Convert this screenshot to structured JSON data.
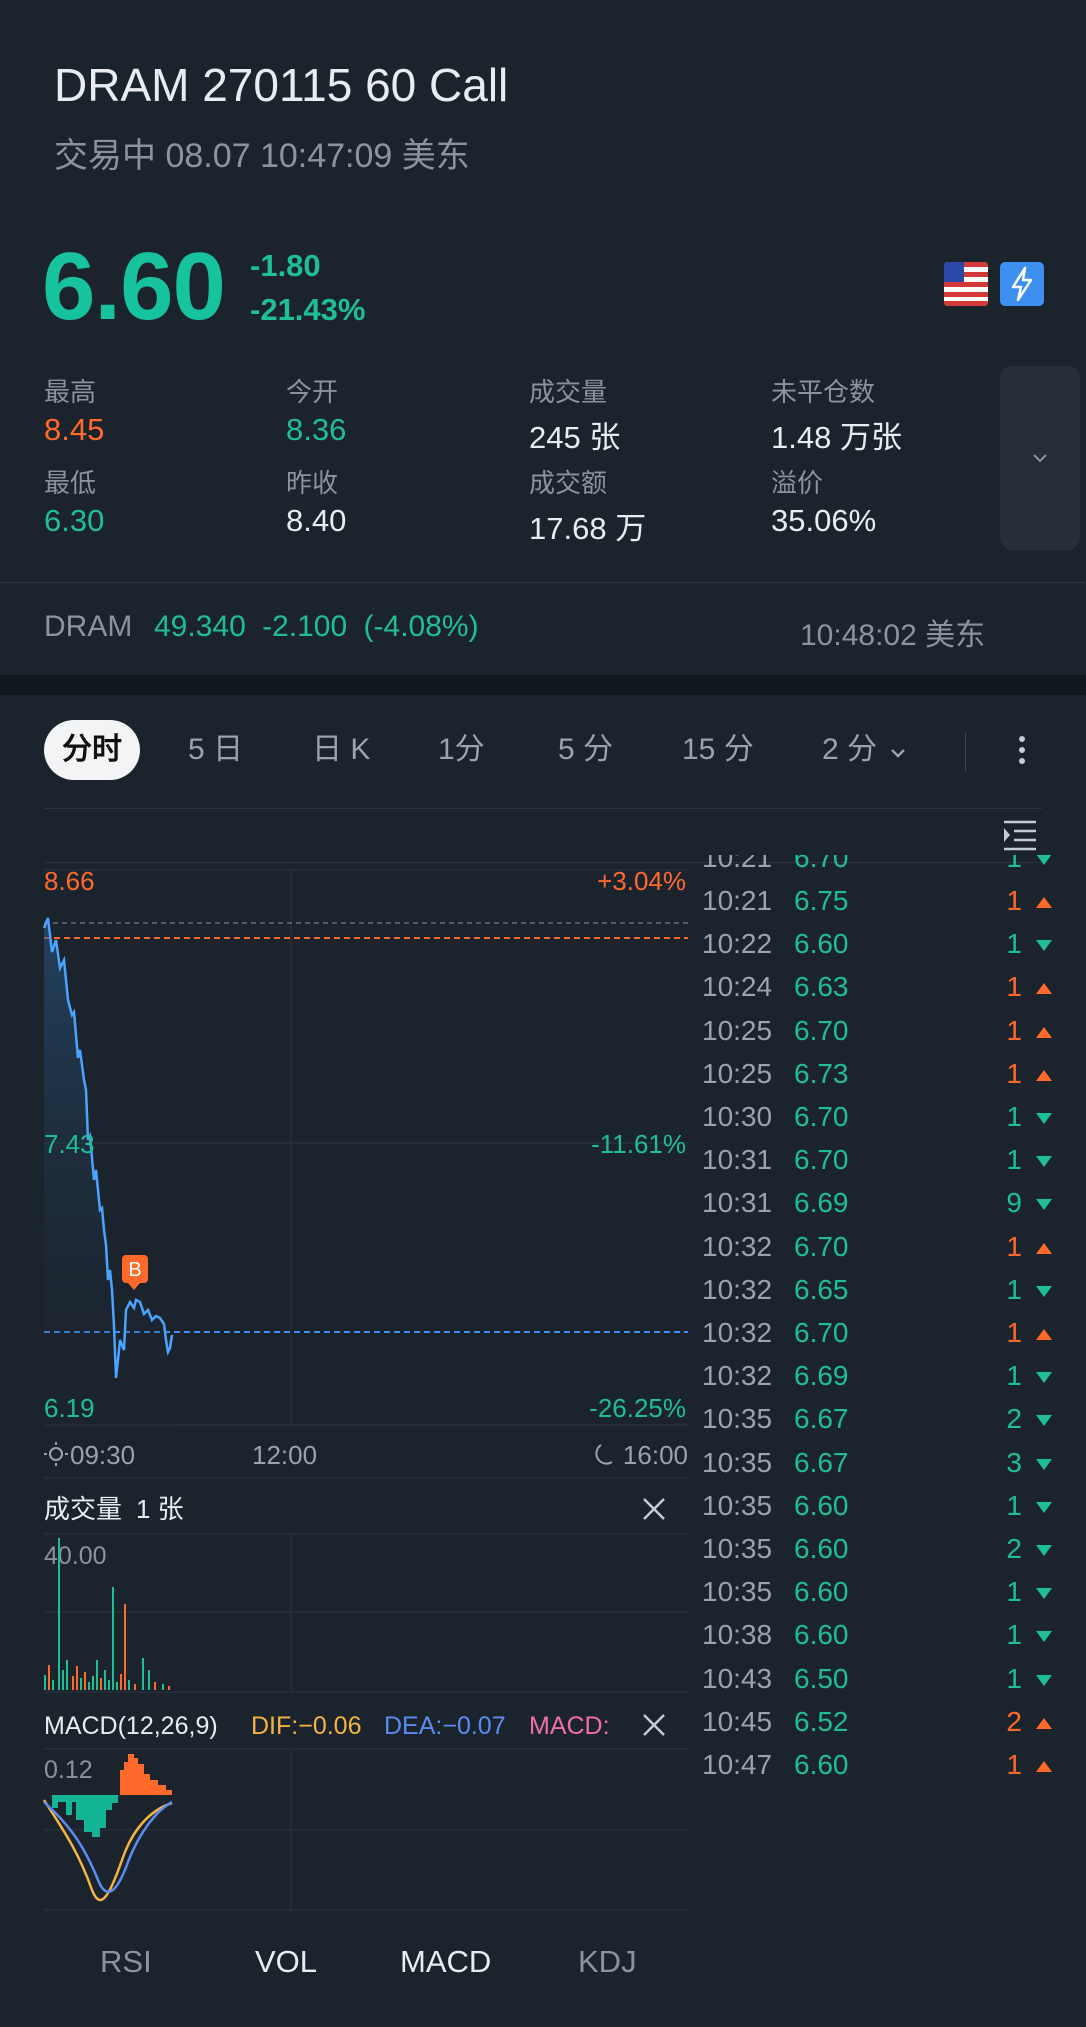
{
  "header": {
    "title": "DRAM 270115 60 Call",
    "subtitle": "交易中 08.07 10:47:09 美东"
  },
  "quote": {
    "price": "6.60",
    "change": "-1.80",
    "change_pct": "-21.43%",
    "flag_icon": "us-flag-icon",
    "fast_icon": "lightning-icon",
    "stats": [
      {
        "label": "最高",
        "value": "8.45",
        "color": "#ff6a2b"
      },
      {
        "label": "今开",
        "value": "8.36",
        "color": "#1fbf95"
      },
      {
        "label": "成交量",
        "value": "245 张",
        "color": "#e9edf1"
      },
      {
        "label": "未平仓数",
        "value": "1.48 万张",
        "color": "#e9edf1"
      },
      {
        "label": "最低",
        "value": "6.30",
        "color": "#1fbf95"
      },
      {
        "label": "昨收",
        "value": "8.40",
        "color": "#e9edf1"
      },
      {
        "label": "成交额",
        "value": "17.68 万",
        "color": "#e9edf1"
      },
      {
        "label": "溢价",
        "value": "35.06%",
        "color": "#e9edf1"
      }
    ]
  },
  "underlying": {
    "symbol": "DRAM",
    "price": "49.340",
    "change": "-2.100",
    "change_pct": "(-4.08%)",
    "time": "10:48:02 美东"
  },
  "tabs": [
    {
      "label": "分时",
      "active": true
    },
    {
      "label": "5 日"
    },
    {
      "label": "日 K"
    },
    {
      "label": "1分"
    },
    {
      "label": "5 分"
    },
    {
      "label": "15 分"
    },
    {
      "label": "2 分"
    }
  ],
  "chart": {
    "y_high": "8.66",
    "y_high_pct": "+3.04%",
    "y_mid": "7.43",
    "y_mid_pct": "-11.61%",
    "y_low": "6.19",
    "y_low_pct": "-26.25%",
    "x_start": "09:30",
    "x_mid": "12:00",
    "x_end": "16:00",
    "marker": "B",
    "volume_label": "成交量",
    "volume_value": "1 张",
    "volume_max": "40.00",
    "macd_label": "MACD(12,26,9)",
    "dif": "DIF:−0.06",
    "dea": "DEA:−0.07",
    "macd": "MACD:",
    "macd_max": "0.12"
  },
  "ticks": [
    {
      "time": "10:21",
      "price": "6.75",
      "vol": "1",
      "dir": "up"
    },
    {
      "time": "10:22",
      "price": "6.60",
      "vol": "1",
      "dir": "down"
    },
    {
      "time": "10:24",
      "price": "6.63",
      "vol": "1",
      "dir": "up"
    },
    {
      "time": "10:25",
      "price": "6.70",
      "vol": "1",
      "dir": "up"
    },
    {
      "time": "10:25",
      "price": "6.73",
      "vol": "1",
      "dir": "up"
    },
    {
      "time": "10:30",
      "price": "6.70",
      "vol": "1",
      "dir": "down"
    },
    {
      "time": "10:31",
      "price": "6.70",
      "vol": "1",
      "dir": "down"
    },
    {
      "time": "10:31",
      "price": "6.69",
      "vol": "9",
      "dir": "down"
    },
    {
      "time": "10:32",
      "price": "6.70",
      "vol": "1",
      "dir": "up"
    },
    {
      "time": "10:32",
      "price": "6.65",
      "vol": "1",
      "dir": "down"
    },
    {
      "time": "10:32",
      "price": "6.70",
      "vol": "1",
      "dir": "up"
    },
    {
      "time": "10:32",
      "price": "6.69",
      "vol": "1",
      "dir": "down"
    },
    {
      "time": "10:35",
      "price": "6.67",
      "vol": "2",
      "dir": "down"
    },
    {
      "time": "10:35",
      "price": "6.67",
      "vol": "3",
      "dir": "down"
    },
    {
      "time": "10:35",
      "price": "6.60",
      "vol": "1",
      "dir": "down"
    },
    {
      "time": "10:35",
      "price": "6.60",
      "vol": "2",
      "dir": "down"
    },
    {
      "time": "10:35",
      "price": "6.60",
      "vol": "1",
      "dir": "down"
    },
    {
      "time": "10:38",
      "price": "6.60",
      "vol": "1",
      "dir": "down"
    },
    {
      "time": "10:43",
      "price": "6.50",
      "vol": "1",
      "dir": "down"
    },
    {
      "time": "10:45",
      "price": "6.52",
      "vol": "2",
      "dir": "up"
    },
    {
      "time": "10:47",
      "price": "6.60",
      "vol": "1",
      "dir": "up"
    }
  ],
  "bottom_tabs": [
    {
      "label": "RSI",
      "active": false
    },
    {
      "label": "VOL",
      "active": true
    },
    {
      "label": "MACD",
      "active": true
    },
    {
      "label": "KDJ",
      "active": false
    }
  ]
}
